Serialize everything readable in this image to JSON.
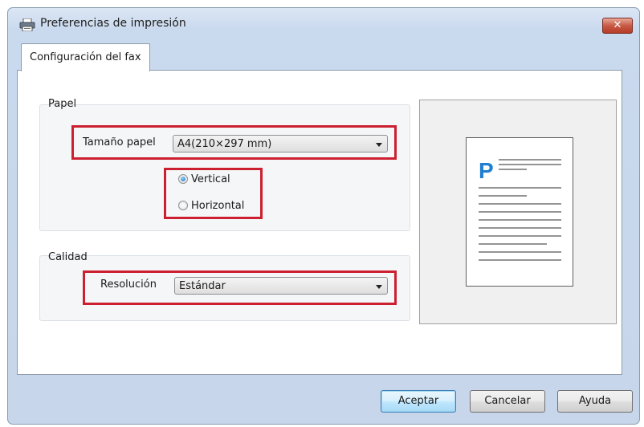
{
  "window": {
    "title": "Preferencias de impresión",
    "close_symbol": "✕",
    "icon": "printer-icon"
  },
  "tab": {
    "label": "Configuración del fax"
  },
  "paper": {
    "group_label": "Papel",
    "size_label": "Tamaño papel",
    "size_value": "A4(210×297 mm)",
    "orientation": {
      "options": [
        "Vertical",
        "Horizontal"
      ],
      "selected": "Vertical"
    }
  },
  "quality": {
    "group_label": "Calidad",
    "resolution_label": "Resolución",
    "resolution_value": "Estándar"
  },
  "preview": {
    "page_letter": "P",
    "accent_color": "#1f7fd0"
  },
  "buttons": {
    "ok": "Aceptar",
    "cancel": "Cancelar",
    "help": "Ayuda"
  },
  "colors": {
    "highlight": "#cc2030",
    "default_button": "#3c7fb1"
  }
}
